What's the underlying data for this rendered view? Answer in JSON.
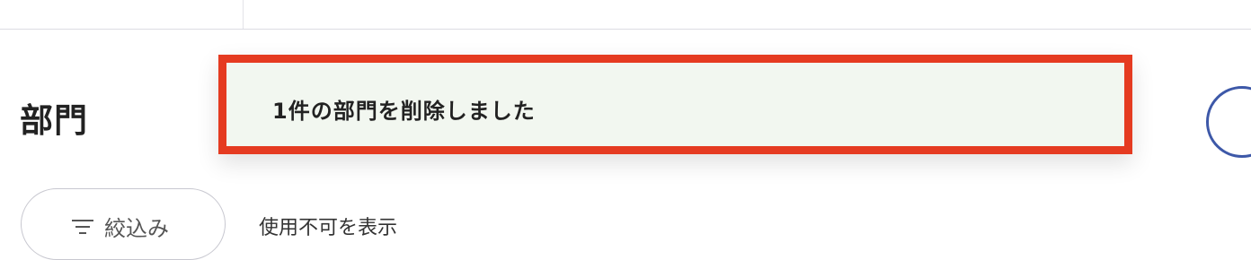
{
  "page": {
    "title": "部門"
  },
  "filter": {
    "label": "絞込み",
    "icon": "filter-lines-icon"
  },
  "toggle": {
    "label": "使用不可を表示"
  },
  "toast": {
    "message": "1件の部門を削除しました",
    "border_color": "#e53b21",
    "background_color": "#f2f7f0"
  },
  "colors": {
    "accent": "#3d58a8"
  }
}
